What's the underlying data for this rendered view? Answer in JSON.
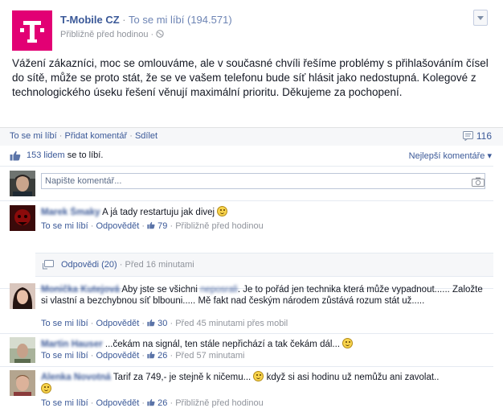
{
  "header": {
    "page_name": "T-Mobile CZ",
    "separator": "·",
    "likes_text": "To se mi líbí (194.571)",
    "time": "Přibližně před hodinou",
    "time_sep": "·",
    "brand_color": "#e20074"
  },
  "post": {
    "text": "Vážení zákazníci, moc se omlouváme, ale v současné chvíli řešíme problémy s přihlašováním čísel do sítě, může se proto stát, že se ve vašem telefonu bude síť hlásit jako nedostupná. Kolegové z technologického úseku řešení věnují maximální prioritu. Děkujeme za pochopení."
  },
  "actions": {
    "like": "To se mi líbí",
    "comment": "Přidat komentář",
    "share": "Sdílet",
    "dot": "·",
    "comment_count": "116"
  },
  "likes": {
    "count_link": "153 lidem",
    "suffix": " se to líbí.",
    "best_comments": "Nejlepší komentáře ▾"
  },
  "composer": {
    "placeholder": "Napište komentář..."
  },
  "comments": [
    {
      "author": "Marek Šmaky",
      "text": "A já tady restartuju jak divej",
      "like_label": "To se mi líbí",
      "reply_label": "Odpovědět",
      "likes": "79",
      "time": "Přibližně před hodinou"
    },
    {
      "author": "Monička Kutejová",
      "text_before": "Aby jste se všichni",
      "blurred_word": "neposrali",
      "text_after": ". Je to pořád jen technika která může vypadnout...... Založte si vlastní a bezchybnou síť blbouni..... Mě fakt nad českým národem zůstává rozum stát už.....",
      "like_label": "To se mi líbí",
      "reply_label": "Odpovědět",
      "likes": "30",
      "time": "Před 45 minutami přes mobil"
    },
    {
      "author": "Martin Hauser",
      "text": "...čekám na signál, ten stále nepřichází a tak čekám dál...",
      "like_label": "To se mi líbí",
      "reply_label": "Odpovědět",
      "likes": "26",
      "time": "Před 57 minutami"
    },
    {
      "author": "Alenka Novotná",
      "text_before": "Tarif za 749,- je stejně k ničemu...",
      "text_after": "když si asi hodinu už nemůžu ani zavolat..",
      "like_label": "To se mi líbí",
      "reply_label": "Odpovědět",
      "likes": "26",
      "time": "Přibližně před hodinou"
    }
  ],
  "replies": {
    "link": "Odpovědi (20)",
    "time": "Před 16 minutami"
  }
}
